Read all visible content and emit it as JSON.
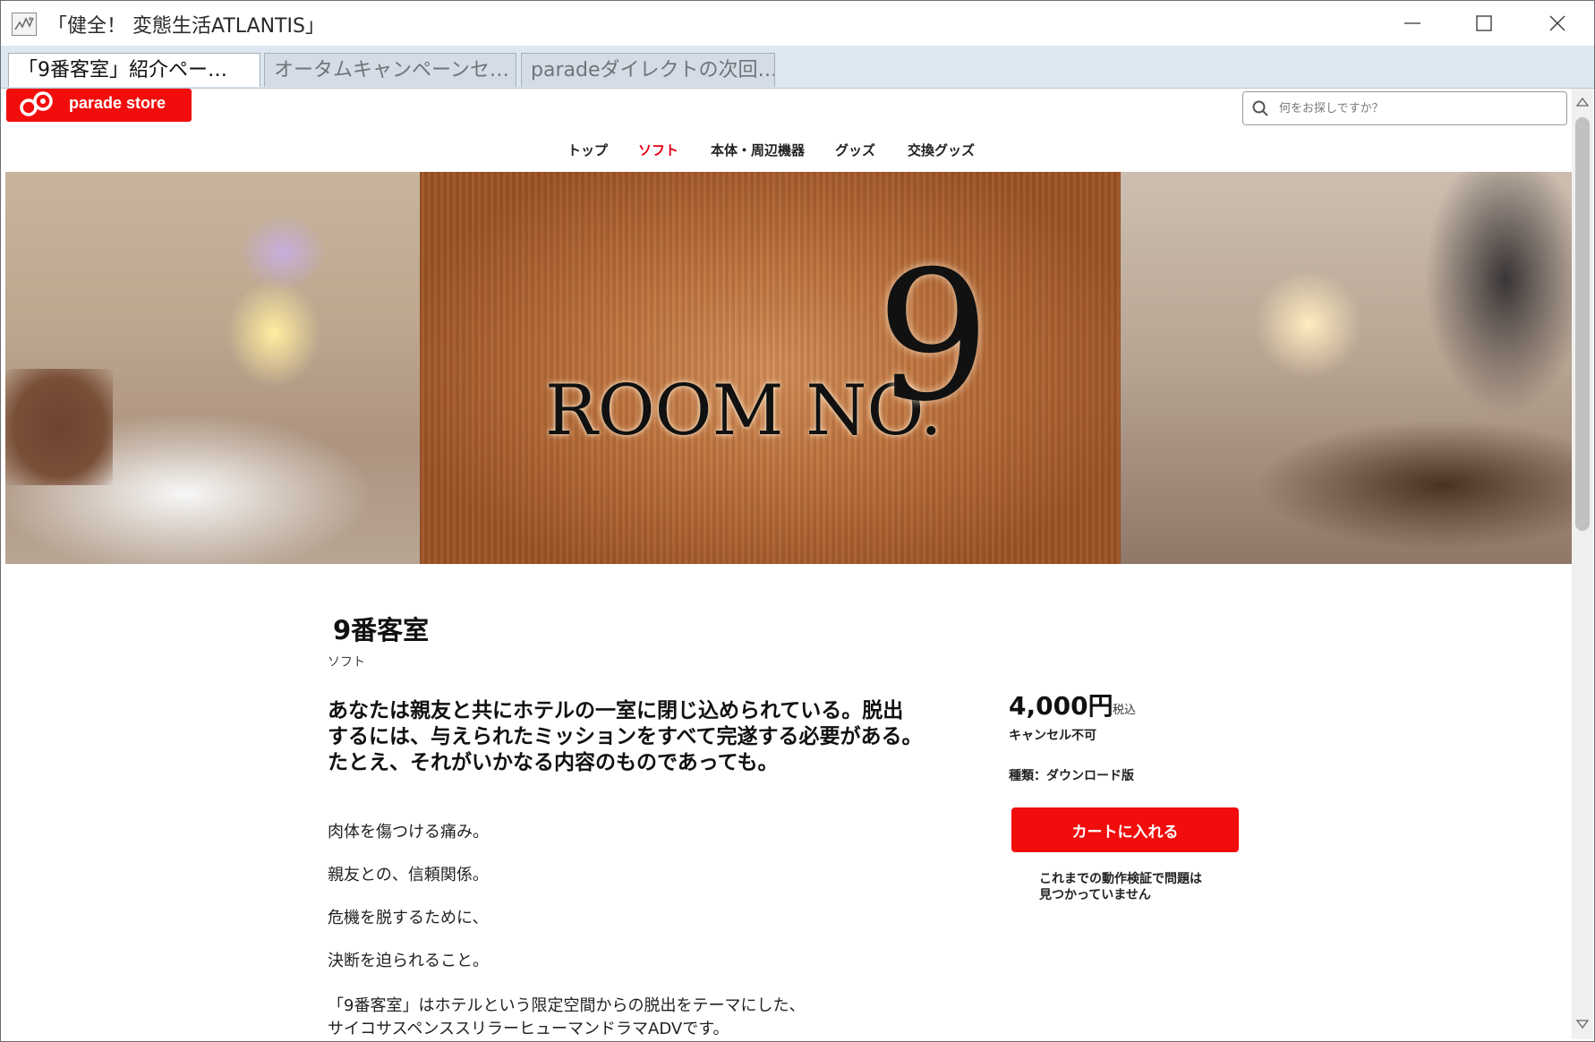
{
  "window": {
    "title": "「健全！ 変態生活ATLANTIS」"
  },
  "tabs": [
    {
      "label": "「9番客室」紹介ペー…",
      "active": true
    },
    {
      "label": "オータムキャンペーンセ…",
      "active": false
    },
    {
      "label": "paradeダイレクトの次回…",
      "active": false
    }
  ],
  "header": {
    "logo_text": "parade store",
    "search_placeholder": "何をお探しですか？",
    "nav": [
      {
        "label": "トップ",
        "current": false
      },
      {
        "label": "ソフト",
        "current": true
      },
      {
        "label": "本体・周辺機器",
        "current": false
      },
      {
        "label": "グッズ",
        "current": false
      },
      {
        "label": "交換グッズ",
        "current": false
      }
    ]
  },
  "banner": {
    "title_word": "ROOM NO.",
    "number": "9"
  },
  "product": {
    "title": "9番客室",
    "category": "ソフト",
    "lead": [
      "あなたは親友と共にホテルの一室に閉じ込められている。脱出",
      "するには、与えられたミッションをすべて完遂する必要がある。",
      "たとえ、それがいかなる内容のものであっても。"
    ],
    "body": [
      "肉体を傷つける痛み。",
      "親友との、信頼関係。",
      "危機を脱するために、",
      "決断を迫られること。",
      "「9番客室」はホテルという限定空間からの脱出をテーマにした、",
      "サイコサスペンススリラーヒューマンドラマADVです。"
    ],
    "price": "4,000円",
    "tax_label": "税込",
    "cancel_note": "キャンセル不可",
    "kind": "種類：ダウンロード版",
    "cart_button": "カートに入れる",
    "verify_note": [
      "これまでの動作検証で問題は",
      "見つかっていません"
    ]
  },
  "colors": {
    "brand_red": "#f20d0d",
    "nav_active": "#e60012",
    "tabstrip_bg": "#dce7f1"
  }
}
